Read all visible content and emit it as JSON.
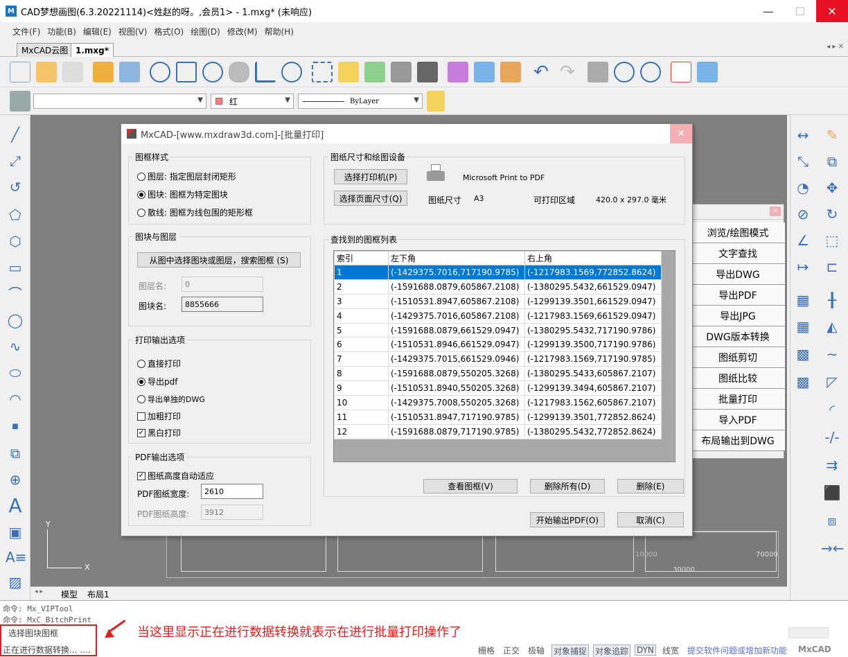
{
  "window": {
    "title": "CAD梦想画图(6.3.20221114)<姓赵的呀。,会员1> - 1.mxg* (未响应)"
  },
  "menu": [
    "文件(F)",
    "功能(B)",
    "编辑(E)",
    "视图(V)",
    "格式(O)",
    "绘图(D)",
    "修改(M)",
    "帮助(H)"
  ],
  "tabs": [
    {
      "label": "MxCAD云图"
    },
    {
      "label": "1.mxg*"
    }
  ],
  "props": {
    "layer": "",
    "color": "红",
    "linetype": "ByLayer"
  },
  "dialog": {
    "title": "MxCAD-[www.mxdraw3d.com]-[批量打印]",
    "frame_style": {
      "label": "图框样式",
      "options": [
        "图层: 指定图层封闭矩形",
        "图块: 图框为特定图块",
        "散线: 图框为线包围的矩形框"
      ]
    },
    "block_layer": {
      "label": "图块与图层",
      "select_button": "从图中选择图块或图层，搜索图框 (S)",
      "layer_label": "图层名:",
      "layer_value": "0",
      "block_label": "图块名:",
      "block_value": "8855666"
    },
    "print_output": {
      "label": "打印输出选项",
      "options": [
        "直接打印",
        "导出pdf",
        "导出单独的DWG"
      ],
      "bold_print": "加粗打印",
      "bw_print": "黑白打印"
    },
    "pdf_output": {
      "label": "PDF输出选项",
      "auto_height": "图纸高度自动适应",
      "width_label": "PDF图纸宽度:",
      "width_value": "2610",
      "height_label": "PDF图纸高度:",
      "height_value": "3912"
    },
    "paper_device": {
      "label": "图纸尺寸和绘图设备",
      "select_printer": "选择打印机(P)",
      "select_page": "选择页面尺寸(Q)",
      "printer_name": "Microsoft Print to PDF",
      "paper_size_label": "图纸尺寸",
      "paper_size": "A3",
      "printable_label": "可打印区域",
      "printable_value": "420.0 x 297.0 毫米"
    },
    "frame_list": {
      "label": "查找到的图框列表",
      "columns": [
        "索引",
        "左下角",
        "右上角"
      ],
      "rows": [
        [
          "1",
          "(-1429375.7016,717190.9785)",
          "(-1217983.1569,772852.8624)"
        ],
        [
          "2",
          "(-1591688.0879,605867.2108)",
          "(-1380295.5432,661529.0947)"
        ],
        [
          "3",
          "(-1510531.8947,605867.2108)",
          "(-1299139.3501,661529.0947)"
        ],
        [
          "4",
          "(-1429375.7016,605867.2108)",
          "(-1217983.1569,661529.0947)"
        ],
        [
          "5",
          "(-1591688.0879,661529.0947)",
          "(-1380295.5432,717190.9786)"
        ],
        [
          "6",
          "(-1510531.8946,661529.0947)",
          "(-1299139.3500,717190.9786)"
        ],
        [
          "7",
          "(-1429375.7015,661529.0946)",
          "(-1217983.1569,717190.9785)"
        ],
        [
          "8",
          "(-1591688.0879,550205.3268)",
          "(-1380295.5433,605867.2107)"
        ],
        [
          "9",
          "(-1510531.8940,550205.3268)",
          "(-1299139.3494,605867.2107)"
        ],
        [
          "10",
          "(-1429375.7008,550205.3268)",
          "(-1217983.1562,605867.2107)"
        ],
        [
          "11",
          "(-1510531.8947,717190.9785)",
          "(-1299139.3501,772852.8624)"
        ],
        [
          "12",
          "(-1591688.0879,717190.9785)",
          "(-1380295.5432,772852.8624)"
        ]
      ],
      "view_button": "查看图框(V)",
      "delete_all_button": "删除所有(D)",
      "delete_button": "删除(E)"
    },
    "start_button": "开始输出PDF(O)",
    "cancel_button": "取消(C)"
  },
  "right_panel": {
    "buttons": [
      "浏览/绘图模式",
      "文字查找",
      "导出DWG",
      "导出PDF",
      "导出JPG",
      "DWG版本转换",
      "图纸剪切",
      "图纸比较",
      "批量打印",
      "导入PDF",
      "布局输出到DWG"
    ]
  },
  "canvas": {
    "dim1": "10000",
    "dim2": "70000",
    "dim3": "30000",
    "axis_y": "Y",
    "axis_x": "X"
  },
  "layout_tabs": [
    "模型",
    "布局1"
  ],
  "command": {
    "line1": "命令: Mx_VIPTool",
    "line2": "命令: MxC_BitchPrint",
    "line3": "选择图块图框",
    "line4": "正在进行数据转换... ...."
  },
  "annotation": "当这里显示正在进行数据转换就表示在进行批量打印操作了",
  "status": [
    "栅格",
    "正交",
    "极轴",
    "对象捕捉",
    "对象追踪",
    "DYN",
    "线宽"
  ],
  "status_link": "提交软件问题或增加新功能",
  "brand": "MxCAD",
  "colors": {
    "accent": "#0078d7",
    "annotation": "#e31c1c",
    "close": "#e81123"
  }
}
